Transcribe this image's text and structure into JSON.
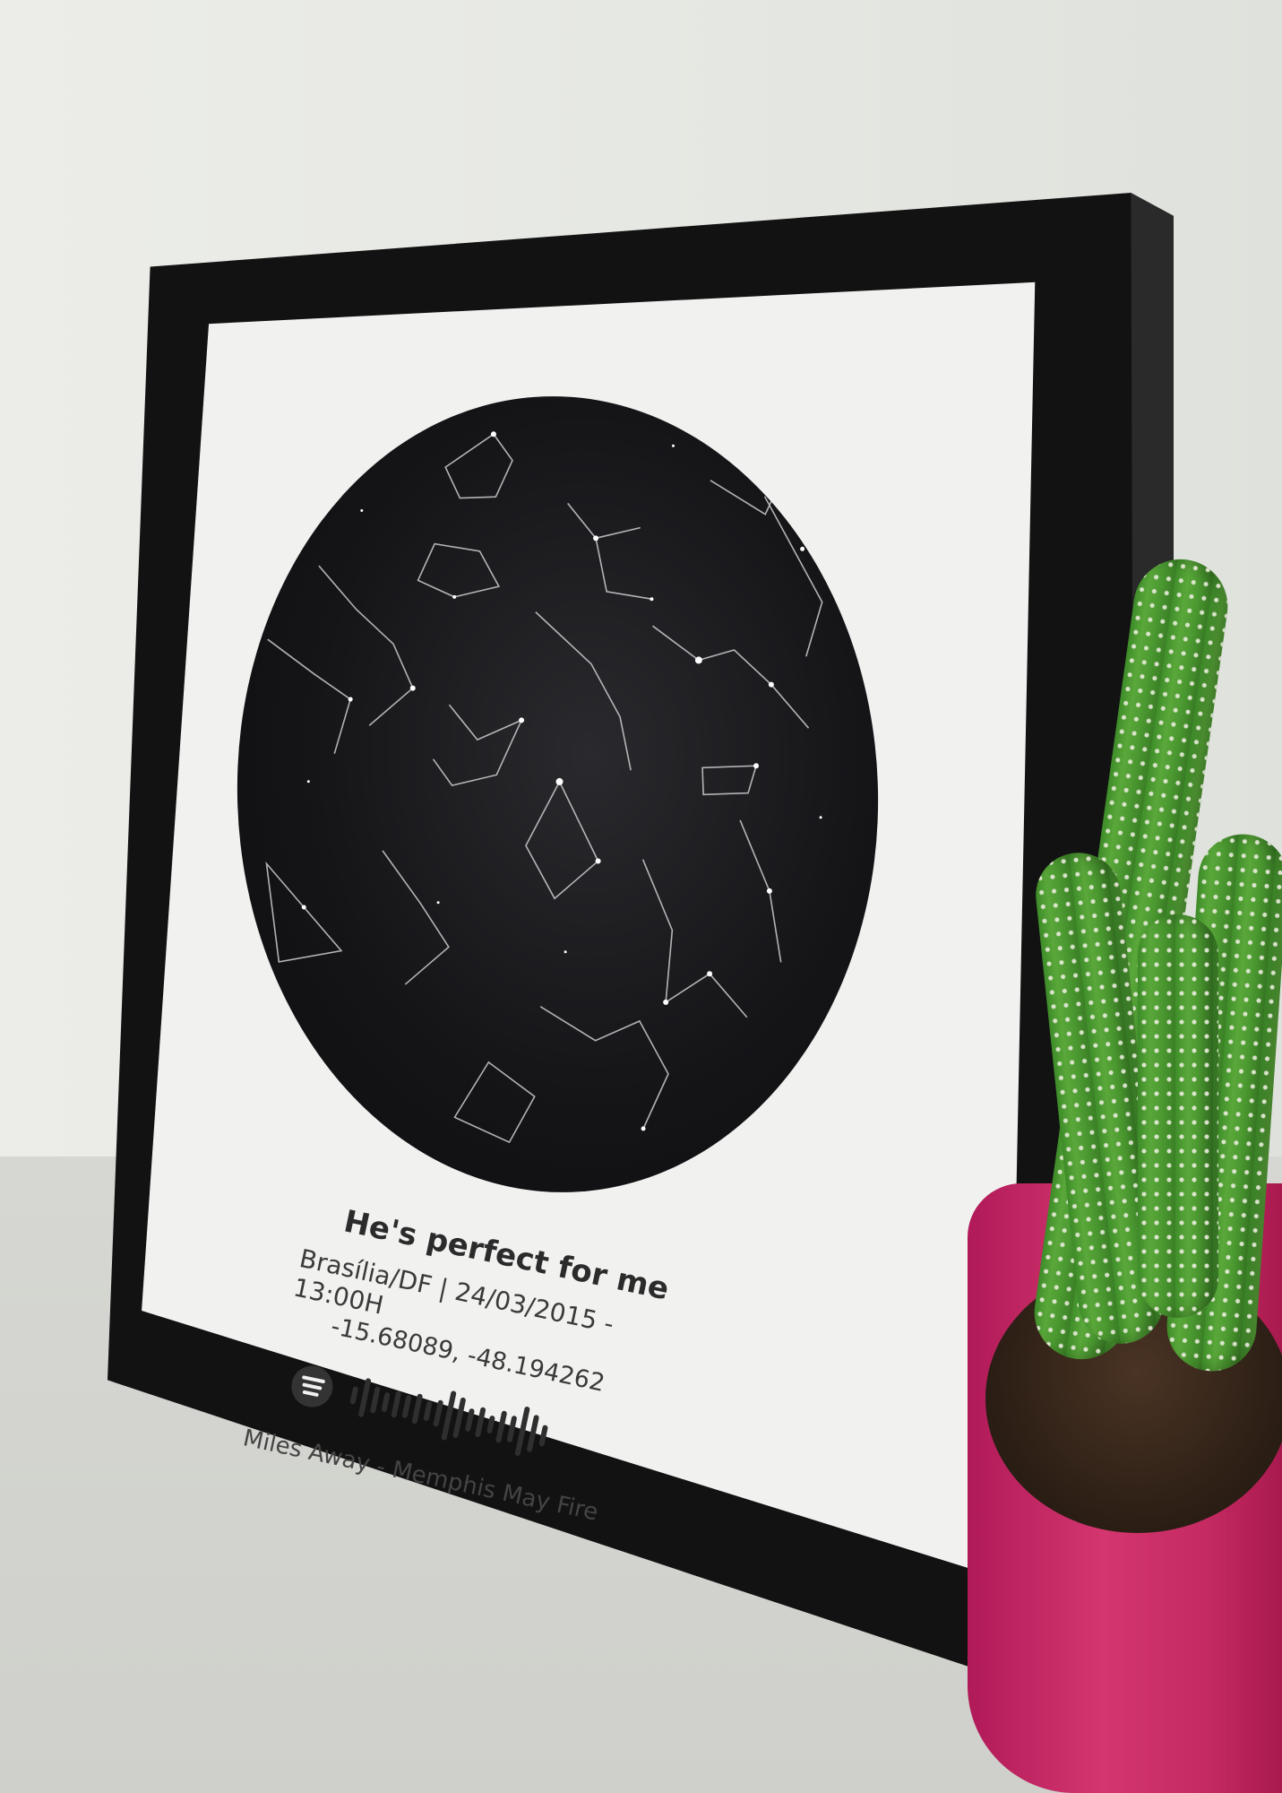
{
  "poster": {
    "title": "He's perfect for me",
    "location_date": "Brasília/DF | 24/03/2015 - 13:00H",
    "coordinates": "-15.68089, -48.194262",
    "song": "Miles Away - Memphis May Fire",
    "spotify_icon": "spotify-icon",
    "scan_code": "spotify-scan-code"
  },
  "colors": {
    "frame": "#121212",
    "mat": "#f1f2f0",
    "sky": "#151518",
    "pot": "#c52a62",
    "cactus": "#4a9830"
  }
}
